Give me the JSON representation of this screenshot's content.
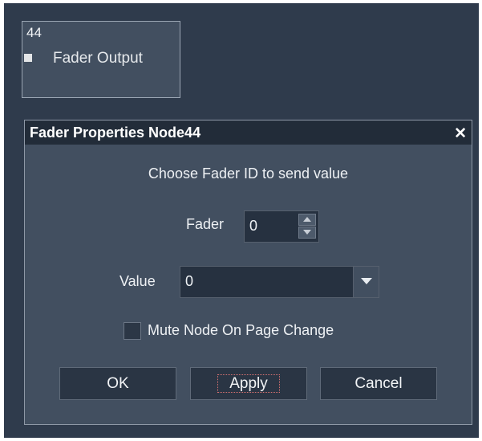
{
  "node": {
    "id": "44",
    "label": "Fader Output"
  },
  "dialog": {
    "title": "Fader Properties Node44",
    "close_glyph": "✕",
    "prompt": "Choose Fader ID to send value",
    "fader": {
      "label": "Fader",
      "value": "0"
    },
    "value_field": {
      "label": "Value",
      "value": "0"
    },
    "mute_checkbox": {
      "label": "Mute Node On Page Change",
      "checked": false
    },
    "buttons": {
      "ok": "OK",
      "apply": "Apply",
      "cancel": "Cancel"
    }
  },
  "colors": {
    "canvas_bg": "#2f3b4c",
    "panel_bg": "#424f60",
    "titlebar_bg": "#222c39",
    "field_bg": "#263140",
    "text": "#eef1f4"
  },
  "icons": {
    "node_port": "node-port-icon",
    "close": "close-icon",
    "spin_up": "arrow-up-icon",
    "spin_down": "arrow-down-icon",
    "dropdown": "chevron-down-icon"
  }
}
